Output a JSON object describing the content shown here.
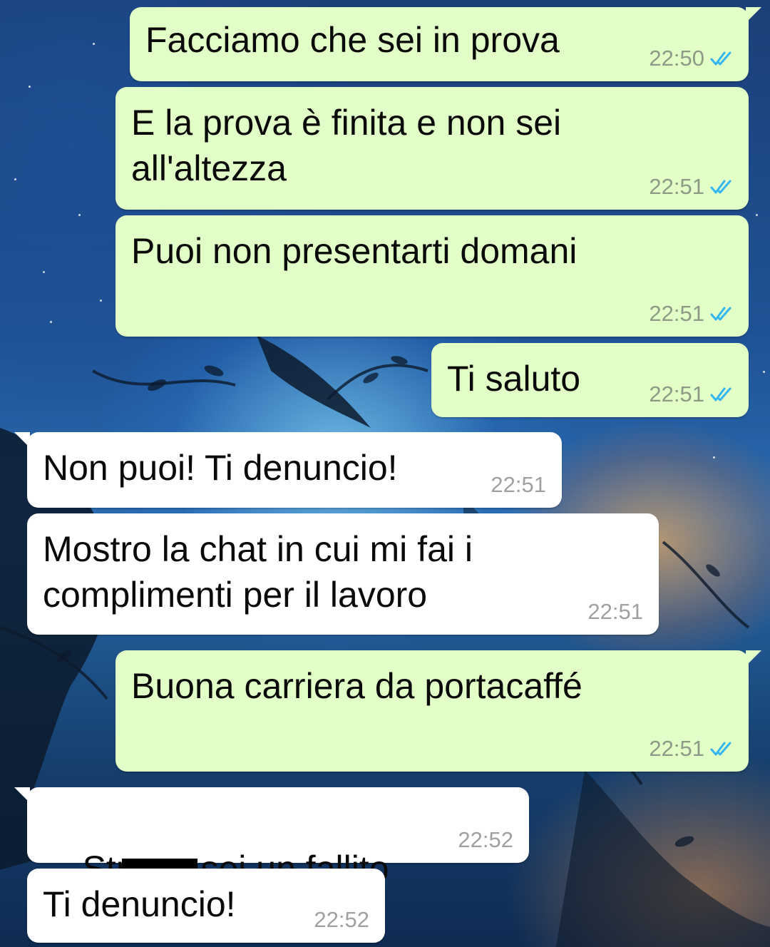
{
  "messages": [
    {
      "direction": "outgoing",
      "text": "Facciamo che sei in prova",
      "time": "22:50",
      "read_icon": "double-check-icon",
      "read_color": "#34b7f1"
    },
    {
      "direction": "outgoing",
      "text": "E la prova è finita e non sei\nall'altezza",
      "time": "22:51",
      "read_icon": "double-check-icon",
      "read_color": "#34b7f1"
    },
    {
      "direction": "outgoing",
      "text": "Puoi non presentarti domani",
      "time": "22:51",
      "read_icon": "double-check-icon",
      "read_color": "#34b7f1"
    },
    {
      "direction": "outgoing",
      "text": "Ti saluto",
      "time": "22:51",
      "read_icon": "double-check-icon",
      "read_color": "#34b7f1"
    },
    {
      "direction": "incoming",
      "text": "Non puoi! Ti denuncio!",
      "time": "22:51"
    },
    {
      "direction": "incoming",
      "text": "Mostro la chat in cui mi fai i\ncomplimenti per il lavoro",
      "time": "22:51"
    },
    {
      "direction": "outgoing",
      "text": "Buona carriera da portacaffé",
      "time": "22:51",
      "read_icon": "double-check-icon",
      "read_color": "#34b7f1"
    },
    {
      "direction": "incoming",
      "text_start": "Str",
      "redaction": "redaction-bar",
      "text_end": "sei un fallito",
      "time": "22:52"
    },
    {
      "direction": "incoming",
      "text": "Ti denuncio!",
      "time": "22:52"
    }
  ],
  "colors": {
    "outgoing_bubble": "#e2ffc7",
    "incoming_bubble": "#ffffff",
    "read_ticks": "#34b7f1"
  }
}
